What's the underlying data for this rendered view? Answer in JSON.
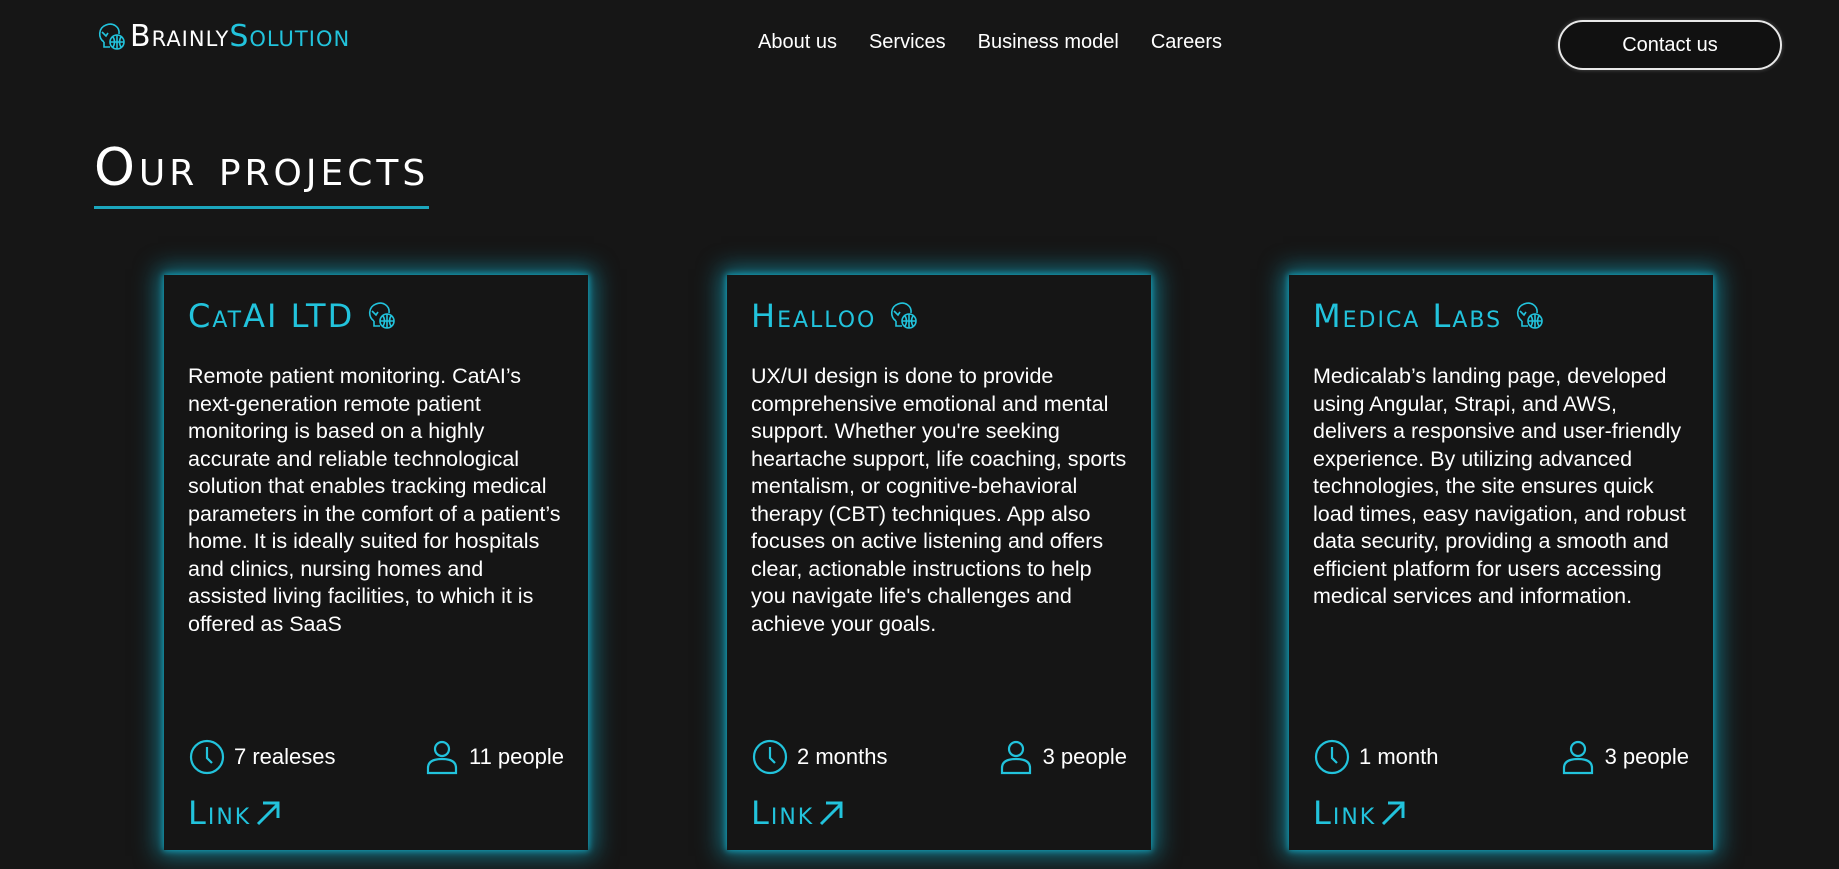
{
  "brand": {
    "part1": "Brainly",
    "part2": "Solution"
  },
  "nav": {
    "items": [
      "About us",
      "Services",
      "Business model",
      "Careers"
    ],
    "contact_label": "Contact us"
  },
  "section": {
    "title": "Our projects"
  },
  "colors": {
    "accent": "#22c3dc",
    "background": "#161616",
    "text": "#ffffff"
  },
  "projects": [
    {
      "title": "CatAI LTD",
      "description": "Remote patient monitoring. CatAI’s next-generation remote patient monitoring is based on a highly accurate and reliable technological solution that enables tracking medical parameters in the comfort of a patient’s home. It is ideally suited for hospitals and clinics, nursing homes and assisted living facilities, to which it is offered as SaaS",
      "duration": "7 realeses",
      "team": "11 people",
      "link_label": "Link"
    },
    {
      "title": "Healloo",
      "description": "UX/UI design is done to provide comprehensive emotional and mental support. Whether you're seeking heartache support, life coaching, sports mentalism, or cognitive-behavioral therapy (CBT) techniques. App also focuses on active listening and offers clear, actionable instructions to help you navigate life's challenges and achieve your goals.",
      "duration": "2 months",
      "team": "3 people",
      "link_label": "Link"
    },
    {
      "title": "Medica Labs",
      "description": "Medicalab’s landing page, developed using Angular, Strapi, and AWS, delivers a responsive and user-friendly experience. By utilizing advanced technologies, the site ensures quick load times, easy navigation, and robust data security, providing a smooth and efficient platform for users accessing medical services and information.",
      "duration": "1 month",
      "team": "3 people",
      "link_label": "Link"
    }
  ],
  "icons": {
    "brand": "brain-bulb-icon",
    "title": "brain-bulb-icon",
    "duration": "clock-icon",
    "team": "person-icon",
    "link": "arrow-up-right-icon"
  }
}
